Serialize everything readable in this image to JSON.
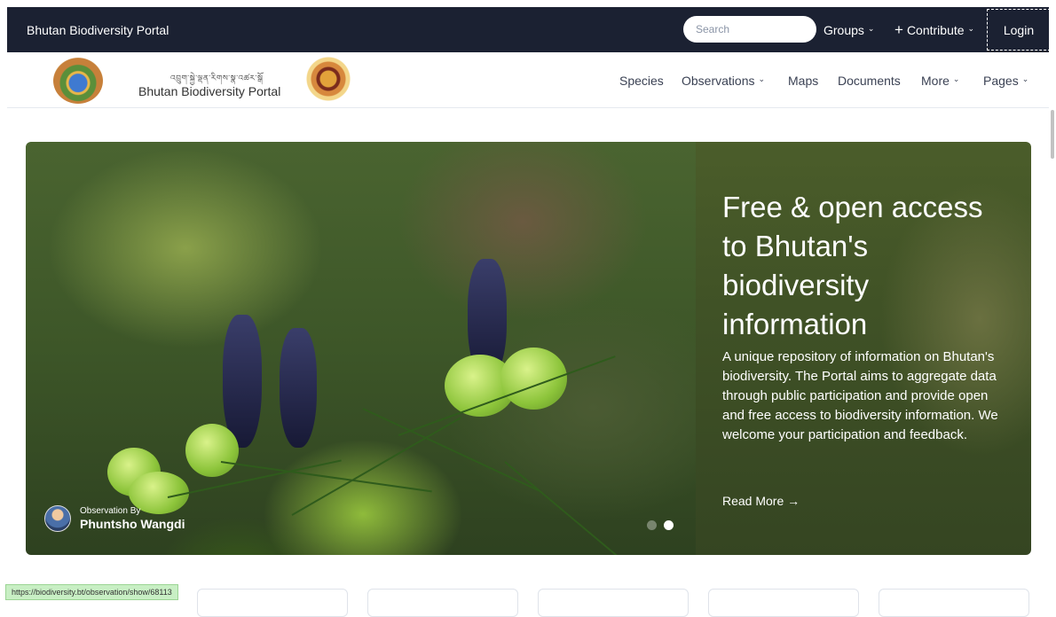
{
  "topbar": {
    "brand": "Bhutan Biodiversity Portal",
    "search_placeholder": "Search",
    "groups": "Groups",
    "contribute": "Contribute",
    "login": "Login"
  },
  "header": {
    "tibetan_text": "འབྲུག་སྐྱེ་ལྡན་རིགས་སྣ་འཚར་སྒོ",
    "portal_name": "Bhutan Biodiversity Portal",
    "nav": {
      "species": "Species",
      "observations": "Observations",
      "maps": "Maps",
      "documents": "Documents",
      "more": "More",
      "pages": "Pages"
    }
  },
  "hero": {
    "title": "Free & open access to Bhutan's biodiversity information",
    "description": "A unique repository of information on Bhutan's biodiversity. The Portal aims to aggregate data through public participation and provide open and free access to biodiversity information. We welcome your participation and feedback.",
    "read_more": "Read More →",
    "observation_by_label": "Observation By",
    "observer_name": "Phuntsho Wangdi",
    "slides_total": 2,
    "slide_active": 2
  },
  "statusbar": {
    "url": "https://biodiversity.bt/observation/show/68113"
  },
  "icons": {
    "chevron": "chevron-down-icon",
    "plus": "plus-icon",
    "arrow": "arrow-right-icon"
  },
  "colors": {
    "topbar_bg": "#1b2132",
    "hero_panel_bg": "#405226"
  }
}
